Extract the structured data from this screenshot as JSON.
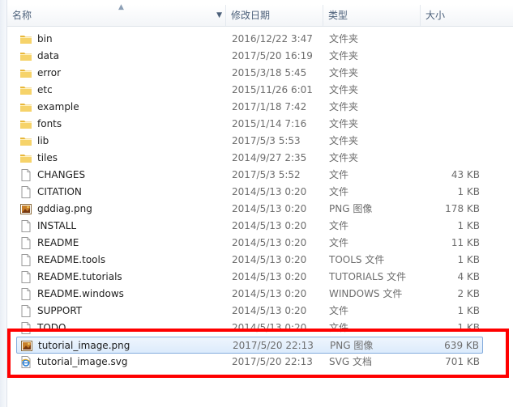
{
  "columns": {
    "name": "名称",
    "date": "修改日期",
    "type": "类型",
    "size": "大小"
  },
  "files": [
    {
      "name": "bin",
      "date": "2016/12/22 3:47",
      "type": "文件夹",
      "size": "",
      "icon": "folder-icon"
    },
    {
      "name": "data",
      "date": "2017/5/20 16:19",
      "type": "文件夹",
      "size": "",
      "icon": "folder-icon"
    },
    {
      "name": "error",
      "date": "2015/3/18 5:45",
      "type": "文件夹",
      "size": "",
      "icon": "folder-icon"
    },
    {
      "name": "etc",
      "date": "2015/11/26 6:01",
      "type": "文件夹",
      "size": "",
      "icon": "folder-icon"
    },
    {
      "name": "example",
      "date": "2017/1/18 7:42",
      "type": "文件夹",
      "size": "",
      "icon": "folder-icon"
    },
    {
      "name": "fonts",
      "date": "2015/1/14 7:16",
      "type": "文件夹",
      "size": "",
      "icon": "folder-icon"
    },
    {
      "name": "lib",
      "date": "2017/5/3 5:53",
      "type": "文件夹",
      "size": "",
      "icon": "folder-icon"
    },
    {
      "name": "tiles",
      "date": "2014/9/27 2:35",
      "type": "文件夹",
      "size": "",
      "icon": "folder-icon"
    },
    {
      "name": "CHANGES",
      "date": "2017/5/3 5:52",
      "type": "文件",
      "size": "43 KB",
      "icon": "file-icon"
    },
    {
      "name": "CITATION",
      "date": "2014/5/13 0:20",
      "type": "文件",
      "size": "1 KB",
      "icon": "file-icon"
    },
    {
      "name": "gddiag.png",
      "date": "2014/5/13 0:20",
      "type": "PNG 图像",
      "size": "178 KB",
      "icon": "image-icon"
    },
    {
      "name": "INSTALL",
      "date": "2014/5/13 0:20",
      "type": "文件",
      "size": "1 KB",
      "icon": "file-icon"
    },
    {
      "name": "README",
      "date": "2014/5/13 0:20",
      "type": "文件",
      "size": "11 KB",
      "icon": "file-icon"
    },
    {
      "name": "README.tools",
      "date": "2014/5/13 0:20",
      "type": "TOOLS 文件",
      "size": "1 KB",
      "icon": "file-icon"
    },
    {
      "name": "README.tutorials",
      "date": "2014/5/13 0:20",
      "type": "TUTORIALS 文件",
      "size": "4 KB",
      "icon": "file-icon"
    },
    {
      "name": "README.windows",
      "date": "2014/5/13 0:20",
      "type": "WINDOWS 文件",
      "size": "2 KB",
      "icon": "file-icon"
    },
    {
      "name": "SUPPORT",
      "date": "2014/5/13 0:20",
      "type": "文件",
      "size": "1 KB",
      "icon": "file-icon"
    },
    {
      "name": "TODO",
      "date": "2014/5/13 0:20",
      "type": "文件",
      "size": "1 KB",
      "icon": "file-icon"
    },
    {
      "name": "tutorial_image.png",
      "date": "2017/5/20 22:13",
      "type": "PNG 图像",
      "size": "639 KB",
      "icon": "image-icon",
      "selected": true
    },
    {
      "name": "tutorial_image.svg",
      "date": "2017/5/20 22:13",
      "type": "SVG 文档",
      "size": "701 KB",
      "icon": "ie-document-icon"
    }
  ]
}
